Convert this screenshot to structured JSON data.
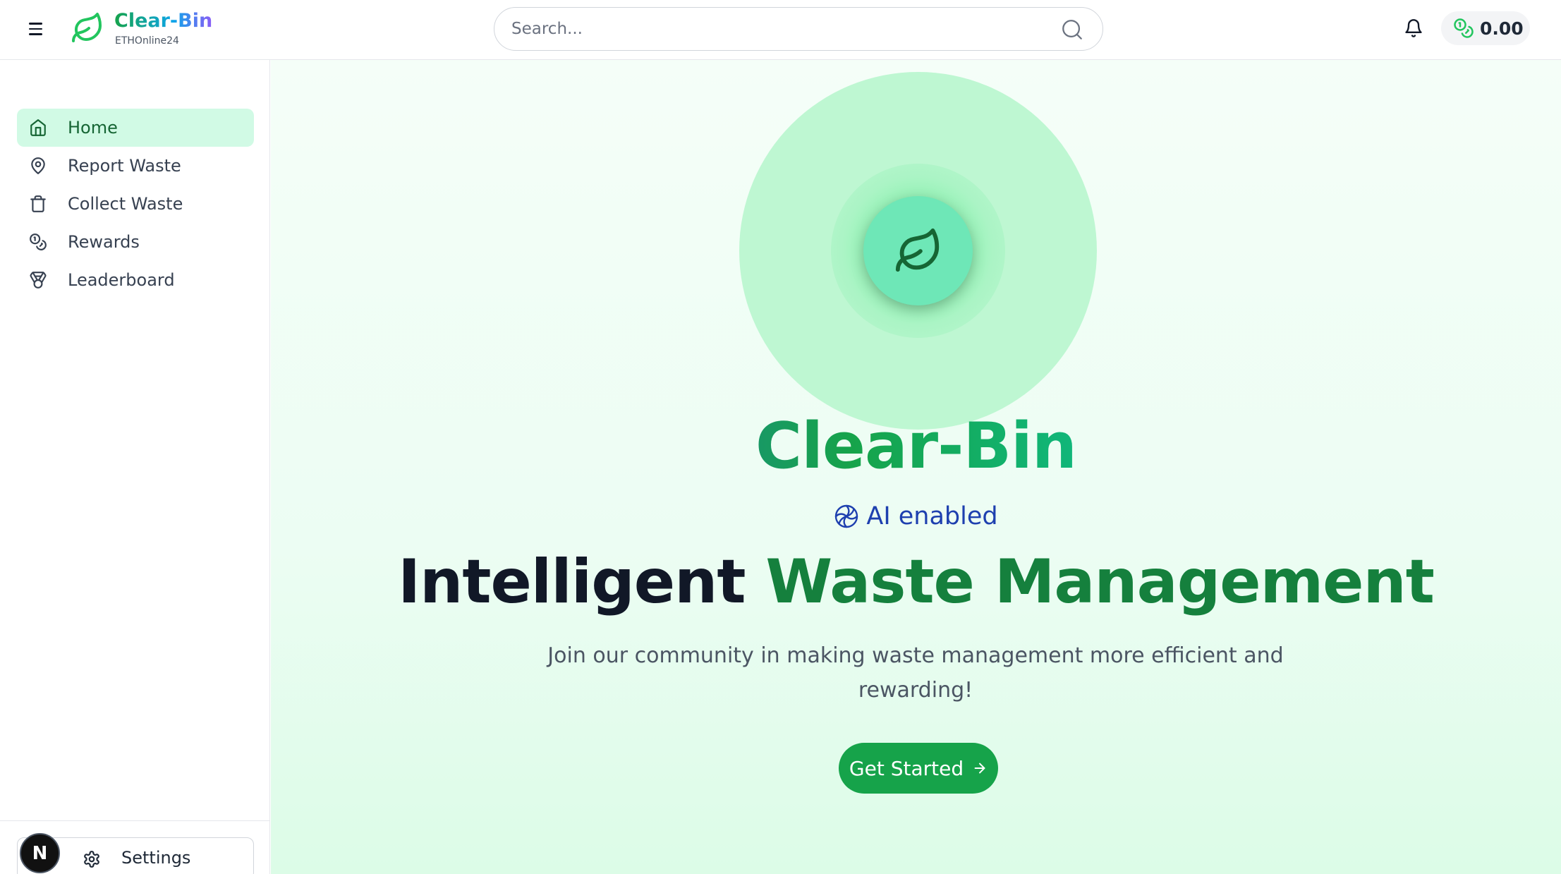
{
  "header": {
    "logo_title": "Clear-Bin",
    "logo_subtitle": "ETHOnline24",
    "search_placeholder": "Search...",
    "balance": "0.00",
    "icons": [
      "menu-icon",
      "leaf-icon",
      "search-icon",
      "bell-icon",
      "coins-icon"
    ]
  },
  "sidebar": {
    "items": [
      {
        "label": "Home",
        "icon": "home-icon",
        "active": true
      },
      {
        "label": "Report Waste",
        "icon": "map-pin-icon",
        "active": false
      },
      {
        "label": "Collect Waste",
        "icon": "trash-icon",
        "active": false
      },
      {
        "label": "Rewards",
        "icon": "coins-icon",
        "active": false
      },
      {
        "label": "Leaderboard",
        "icon": "medal-icon",
        "active": false
      }
    ],
    "settings_label": "Settings",
    "avatar_initial": "N"
  },
  "hero": {
    "brand": "Clear-Bin",
    "badge": "AI enabled",
    "headline_part1": "Intelligent",
    "headline_part2": "Waste Management",
    "subtitle": "Join our community in making waste management more efficient and rewarding!",
    "cta_label": "Get Started"
  },
  "colors": {
    "accent": "#16a34a",
    "active_bg": "#d1fae5",
    "hero_circle": "#bbf7d0",
    "badge_text": "#1e40af"
  }
}
